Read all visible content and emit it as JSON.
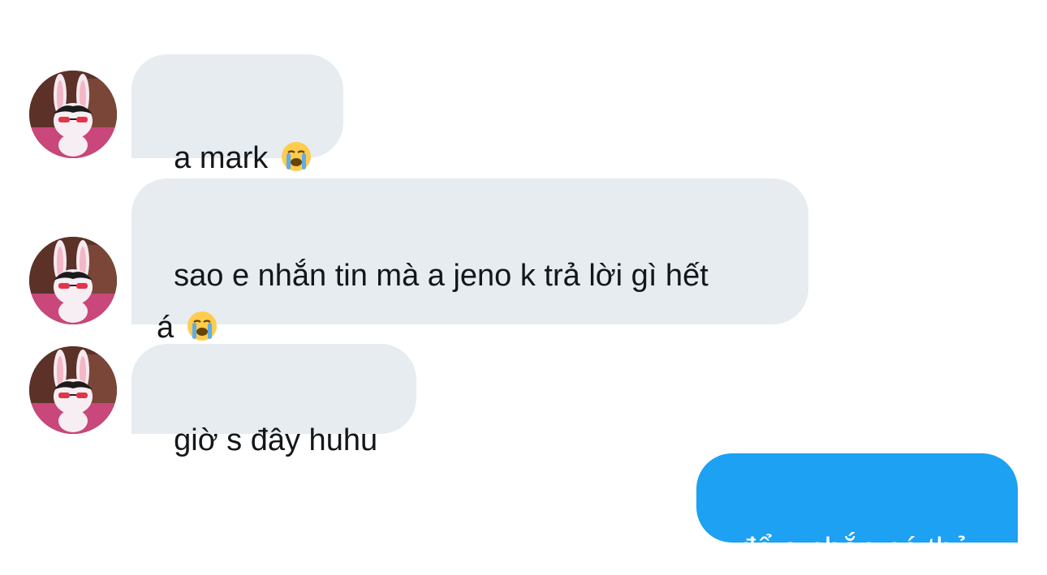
{
  "conversation": {
    "messages": [
      {
        "sender": "other",
        "text": "a mark ",
        "emoji": "loudly-crying-face"
      },
      {
        "sender": "other",
        "text": "sao e nhắn tin mà a jeno k trả lời gì hết\ná ",
        "emoji": "loudly-crying-face"
      },
      {
        "sender": "other",
        "text": "giờ s đây huhu"
      },
      {
        "sender": "me",
        "text": "để a nhắn nó thử"
      }
    ]
  },
  "colors": {
    "incoming_bubble": "#e6ecf0",
    "outgoing_bubble": "#1da1f2",
    "incoming_text": "#14171a",
    "outgoing_text": "#ffffff"
  },
  "icons": {
    "avatar": "bunny-avatar-icon",
    "emoji": "loudly-crying-face-icon"
  }
}
